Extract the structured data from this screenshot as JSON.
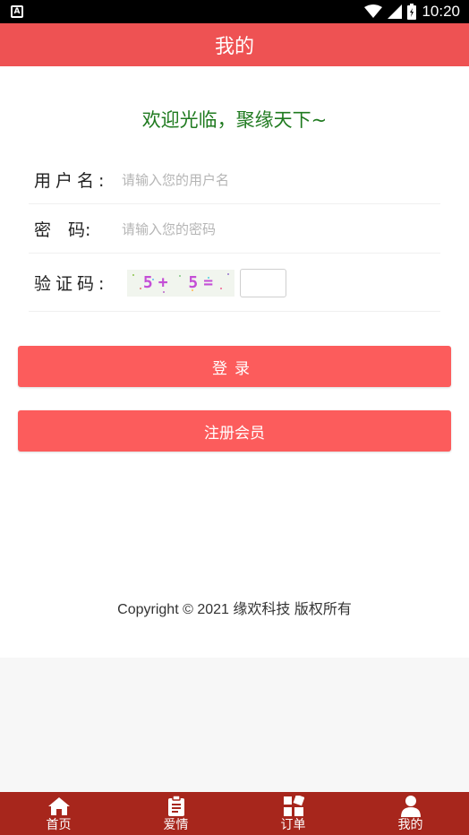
{
  "status": {
    "time": "10:20",
    "left_icon": "A"
  },
  "header": {
    "title": "我的"
  },
  "welcome": "欢迎光临，聚缘天下~",
  "form": {
    "username_label": "用户名:",
    "username_placeholder": "请输入您的用户名",
    "password_label": "密　码:",
    "password_placeholder": "请输入您的密码",
    "captcha_label": "验证码:",
    "captcha_text": "5+ 5="
  },
  "buttons": {
    "login": "登录",
    "register": "注册会员"
  },
  "footer": {
    "copyright": "Copyright © 2021 缘欢科技 版权所有"
  },
  "tabs": [
    {
      "label": "首页",
      "icon": "home-icon"
    },
    {
      "label": "爱情",
      "icon": "list-icon"
    },
    {
      "label": "订单",
      "icon": "grid-icon"
    },
    {
      "label": "我的",
      "icon": "user-icon"
    }
  ],
  "colors": {
    "header": "#ee5253",
    "button": "#fc5c5c",
    "tabbar": "#a7261c",
    "welcome": "#1f7a1f"
  }
}
